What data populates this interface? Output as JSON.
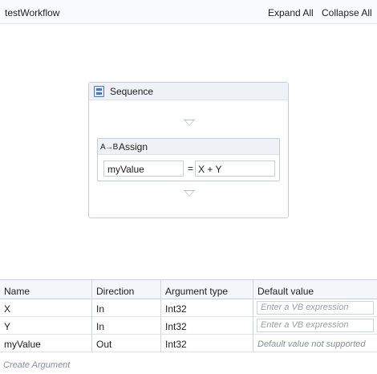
{
  "header": {
    "title": "testWorkflow",
    "expand_all": "Expand All",
    "collapse_all": "Collapse All"
  },
  "designer": {
    "sequence": {
      "label": "Sequence",
      "icon": "sequence-icon"
    },
    "assign": {
      "label": "Assign",
      "icon_text": "A→B",
      "to": "myValue",
      "operator": "=",
      "value": "X + Y"
    }
  },
  "arguments": {
    "columns": [
      "Name",
      "Direction",
      "Argument type",
      "Default value"
    ],
    "rows": [
      {
        "name": "X",
        "direction": "In",
        "type": "Int32",
        "default": "Enter a VB expression"
      },
      {
        "name": "Y",
        "direction": "In",
        "type": "Int32",
        "default": "Enter a VB expression"
      },
      {
        "name": "myValue",
        "direction": "Out",
        "type": "Int32",
        "default": "Default value not supported"
      }
    ],
    "create_label": "Create Argument"
  }
}
